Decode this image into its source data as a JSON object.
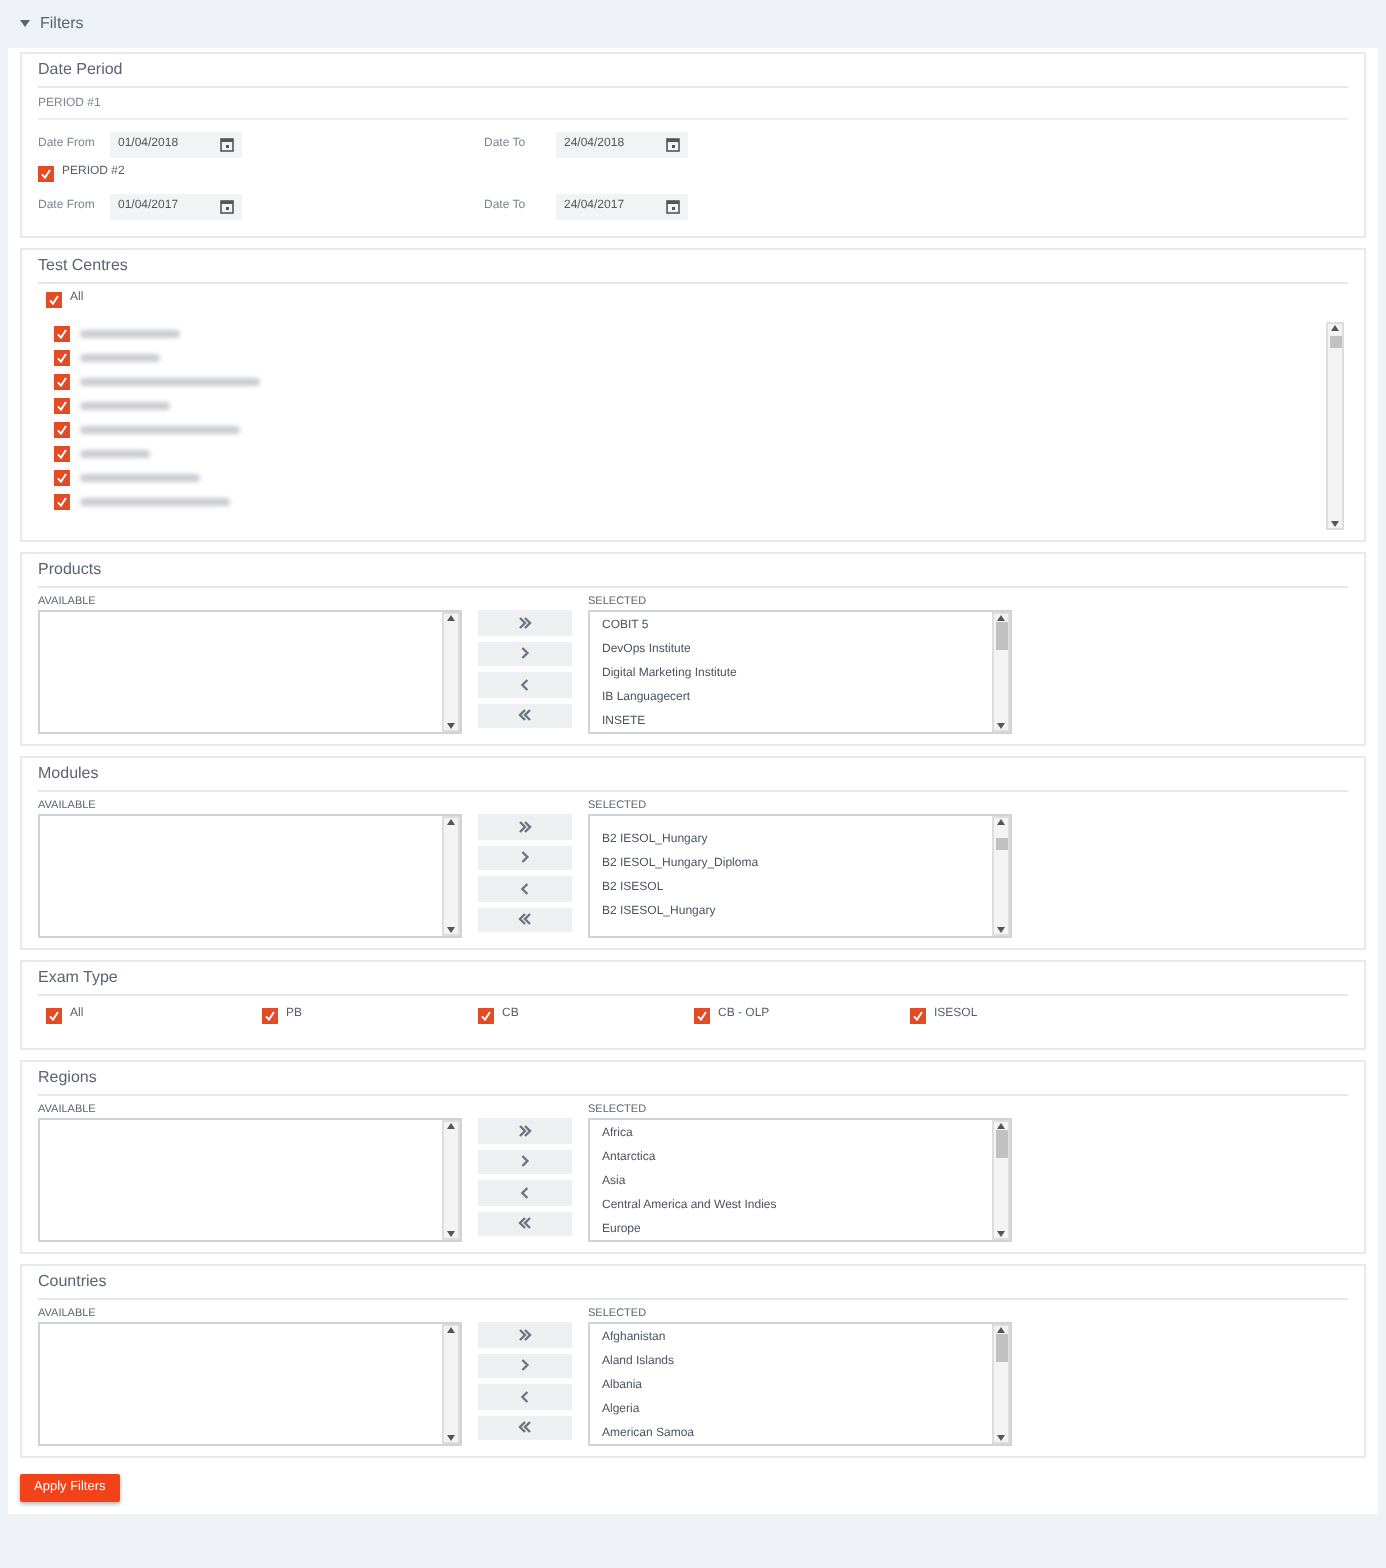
{
  "header": {
    "title": "Filters",
    "expanded": true
  },
  "date_period": {
    "title": "Date Period",
    "periods": [
      {
        "kind": "heading",
        "label": "PERIOD #1",
        "from_label": "Date From",
        "from": "01/04/2018",
        "to_label": "Date To",
        "to": "24/04/2018"
      },
      {
        "kind": "checkbox",
        "label": "PERIOD #2",
        "checked": true,
        "from_label": "Date From",
        "from": "01/04/2017",
        "to_label": "Date To",
        "to": "24/04/2017"
      }
    ]
  },
  "test_centres": {
    "title": "Test Centres",
    "all": {
      "label": "All",
      "checked": true
    },
    "items": [
      {
        "checked": true
      },
      {
        "checked": true
      },
      {
        "checked": true
      },
      {
        "checked": true
      },
      {
        "checked": true
      },
      {
        "checked": true
      },
      {
        "checked": true
      },
      {
        "checked": true
      }
    ]
  },
  "dual_lists": [
    {
      "title": "Products",
      "available_label": "AVAILABLE",
      "selected_label": "SELECTED",
      "selected": [
        "COBIT 5",
        "DevOps Institute",
        "Digital Marketing Institute",
        "IB Languagecert",
        "INSETE"
      ]
    },
    {
      "title": "Modules",
      "available_label": "AVAILABLE",
      "selected_label": "SELECTED",
      "selected": [
        "B2 IESOL_Hungary",
        "B2 IESOL_Hungary_Diploma",
        "B2 ISESOL",
        "B2 ISESOL_Hungary"
      ]
    }
  ],
  "exam_type": {
    "title": "Exam Type",
    "options": [
      {
        "label": "All",
        "checked": true
      },
      {
        "label": "PB",
        "checked": true
      },
      {
        "label": "CB",
        "checked": true
      },
      {
        "label": "CB - OLP",
        "checked": true
      },
      {
        "label": "ISESOL",
        "checked": true
      }
    ]
  },
  "dual_lists_2": [
    {
      "title": "Regions",
      "available_label": "AVAILABLE",
      "selected_label": "SELECTED",
      "selected": [
        "Africa",
        "Antarctica",
        "Asia",
        "Central America and West Indies",
        "Europe"
      ]
    },
    {
      "title": "Countries",
      "available_label": "AVAILABLE",
      "selected_label": "SELECTED",
      "selected": [
        "Afghanistan",
        "Aland Islands",
        "Albania",
        "Algeria",
        "American Samoa"
      ]
    }
  ],
  "apply_button": "Apply Filters"
}
